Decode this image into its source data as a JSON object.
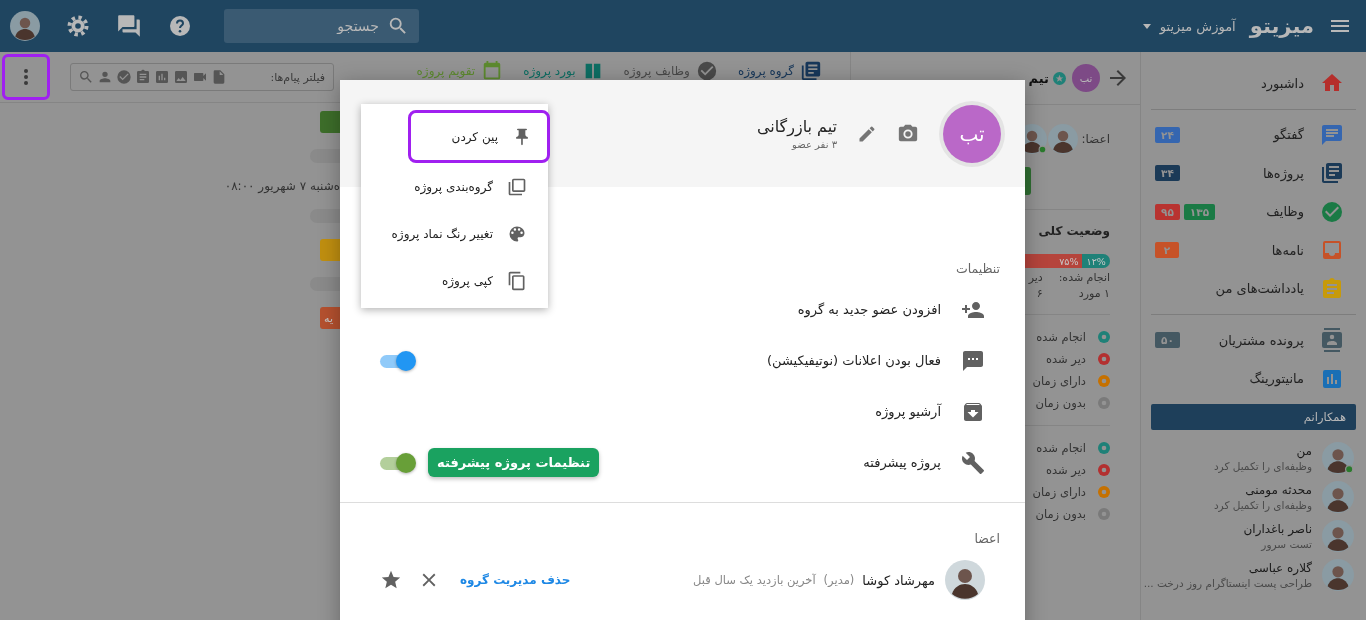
{
  "topbar": {
    "logo": "میزیتو",
    "workspace": "آموزش میزیتو",
    "search": {
      "placeholder": "جستجو"
    }
  },
  "toolbar": {
    "more_button": {
      "highlighted": true
    },
    "filter": {
      "placeholder": "فیلتر پیام‌ها:"
    },
    "tabs": [
      {
        "label": "گروه پروژه",
        "color": "#17375a"
      },
      {
        "label": "وظایف پروژه",
        "color": "#4a4a4a"
      },
      {
        "label": "بورد پروژه",
        "color": "#0d6e63"
      },
      {
        "label": "تقویم پروژه",
        "color": "#5d8a2f"
      }
    ]
  },
  "timeline": [
    {
      "kind": "chip",
      "color": "#3d6e2a"
    },
    {
      "kind": "pill"
    },
    {
      "kind": "date",
      "text": "ه‌شنبه ۷ شهریور ۰۸:۰۰"
    },
    {
      "kind": "pill"
    },
    {
      "kind": "chip",
      "color": "#c08f10"
    },
    {
      "kind": "pill"
    },
    {
      "kind": "chip",
      "color": "#b5512f",
      "label": "یه"
    }
  ],
  "sidebar": {
    "sections": [
      [
        {
          "label": "داشبورد",
          "color": "#b52e2b"
        }
      ],
      [
        {
          "label": "گفتگو",
          "color": "#3566b0",
          "badges": [
            {
              "text": "۲۴",
              "color": "#3566b0"
            }
          ]
        },
        {
          "label": "پروژه‌ها",
          "color": "#1b3a57",
          "badges": [
            {
              "text": "۳۴",
              "color": "#1b3a57"
            }
          ]
        },
        {
          "label": "وظایف",
          "color": "#1a7a45",
          "badges": [
            {
              "text": "۱۳۵",
              "color": "#1a7a45"
            },
            {
              "text": "۹۵",
              "color": "#b83330"
            }
          ]
        },
        {
          "label": "نامه‌ها",
          "color": "#c65228",
          "badges": [
            {
              "text": "۲",
              "color": "#c65228"
            }
          ]
        },
        {
          "label": "یادداشت‌های من",
          "color": "#c79a0a"
        }
      ],
      [
        {
          "label": "پرونده مشتریان",
          "color": "#445862",
          "badges": [
            {
              "text": "۵۰",
              "color": "#445862"
            }
          ]
        },
        {
          "label": "مانیتورینگ",
          "color": "#1a6fb5"
        }
      ]
    ]
  },
  "colleagues": {
    "title": "همکارانم",
    "people": [
      {
        "name": "من",
        "status": "وظیفه‌ای را تکمیل کرد",
        "online": true
      },
      {
        "name": "محدثه مومنی",
        "status": "وظیفه‌ای را تکمیل کرد",
        "online": false
      },
      {
        "name": "ناصر باغداران",
        "status": "تست سرور",
        "online": false
      },
      {
        "name": "گلاره عباسی",
        "status": "طراحی پست اینستاگرام روز درخت ...",
        "online": false
      }
    ]
  },
  "project_panel": {
    "initials": "تب",
    "title": "تیم",
    "members_label": "اعضا:",
    "member_avatars": [
      {
        "online": false
      },
      {
        "online": true
      }
    ],
    "status_title": "وضعیت کلی",
    "progress": [
      {
        "label": "۱۲%",
        "level": 0.12,
        "color": "#1f8178"
      },
      {
        "label": "۷۵%",
        "color": "#b5443c"
      }
    ],
    "stats": [
      {
        "label": "انجام شده:",
        "value": "۱ مورد"
      },
      {
        "label": "دیر",
        "value": "۶"
      }
    ],
    "legends": [
      [
        {
          "label": "انجام شده",
          "color": "#1f8178"
        },
        {
          "label": "دیر شده",
          "color": "#b33030"
        },
        {
          "label": "دارای زمان",
          "color": "#c67100"
        },
        {
          "label": "بدون زمان",
          "color": "#7a7a7a"
        }
      ],
      [
        {
          "label": "انجام شده",
          "color": "#1f8178"
        },
        {
          "label": "دیر شده",
          "color": "#b33030"
        },
        {
          "label": "دارای زمان",
          "color": "#c67100"
        },
        {
          "label": "بدون زمان",
          "color": "#7a7a7a"
        }
      ]
    ]
  },
  "modal": {
    "initials": "تب",
    "title": "تیم بازرگانی",
    "subtitle": "۳ نفر عضو",
    "menu": [
      {
        "label": "پین کردن",
        "highlighted": true
      },
      {
        "label": "گروه‌بندی پروژه",
        "highlighted": false
      },
      {
        "label": "تغییر رنگ نماد پروژه",
        "highlighted": false
      },
      {
        "label": "کپی پروژه",
        "highlighted": false
      }
    ],
    "settings_label": "تنظیمات",
    "settings": [
      {
        "kind": "action",
        "label": "افزودن عضو جدید به گروه"
      },
      {
        "kind": "toggle",
        "label": "فعال بودن اعلانات (نوتیفیکیشن)",
        "on": true,
        "color": "#2196f3"
      },
      {
        "kind": "action",
        "label": "آرشیو پروژه"
      },
      {
        "kind": "toggle",
        "label": "پروژه پیشرفته",
        "on": true,
        "color": "#689f38",
        "button": "تنظیمات پروژه پیشرفته"
      }
    ],
    "members_label": "اعضا",
    "members": [
      {
        "name": "مهرشاد کوشا",
        "role": "(مدیر)",
        "last_seen": "آخرین بازدید یک سال قبل",
        "action": "حذف مدیریت گروه"
      }
    ]
  }
}
